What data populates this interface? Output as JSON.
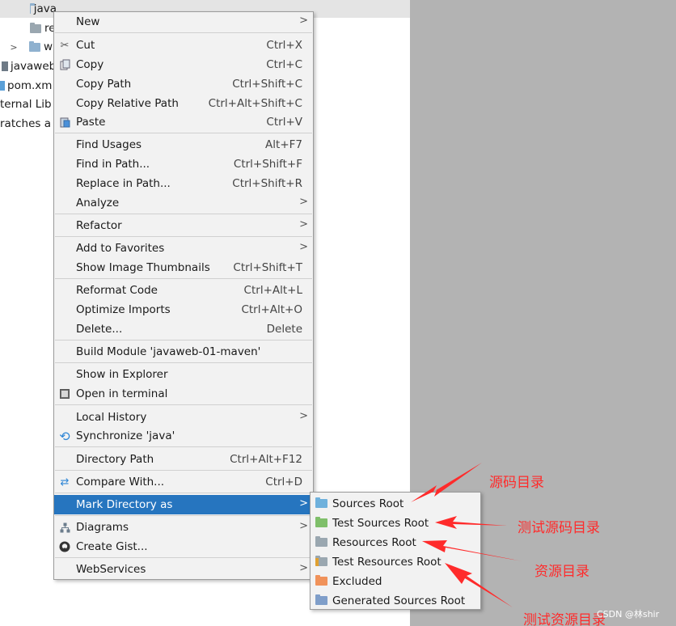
{
  "tree": {
    "rows": [
      {
        "label": "java",
        "icon": "folder-icon"
      },
      {
        "label": "re",
        "icon": "folder-icon"
      },
      {
        "label": "w",
        "icon": "folder-icon"
      },
      {
        "label": "javaweb",
        "icon": "file-icon"
      },
      {
        "label": "pom.xm",
        "icon": "maven-file-icon"
      },
      {
        "label": "ternal Lib",
        "icon": "none"
      },
      {
        "label": "ratches a",
        "icon": "none"
      }
    ]
  },
  "menu": {
    "new": {
      "label": "New",
      "shortcut": ""
    },
    "cut": {
      "label": "Cut",
      "shortcut": "Ctrl+X"
    },
    "copy": {
      "label": "Copy",
      "shortcut": "Ctrl+C"
    },
    "copy_path": {
      "label": "Copy Path",
      "shortcut": "Ctrl+Shift+C"
    },
    "copy_relative_path": {
      "label": "Copy Relative Path",
      "shortcut": "Ctrl+Alt+Shift+C"
    },
    "paste": {
      "label": "Paste",
      "shortcut": "Ctrl+V"
    },
    "find_usages": {
      "label": "Find Usages",
      "shortcut": "Alt+F7"
    },
    "find_in_path": {
      "label": "Find in Path...",
      "shortcut": "Ctrl+Shift+F"
    },
    "replace_in_path": {
      "label": "Replace in Path...",
      "shortcut": "Ctrl+Shift+R"
    },
    "analyze": {
      "label": "Analyze",
      "shortcut": ""
    },
    "refactor": {
      "label": "Refactor",
      "shortcut": ""
    },
    "add_to_favorites": {
      "label": "Add to Favorites",
      "shortcut": ""
    },
    "show_image_thumbnails": {
      "label": "Show Image Thumbnails",
      "shortcut": "Ctrl+Shift+T"
    },
    "reformat_code": {
      "label": "Reformat Code",
      "shortcut": "Ctrl+Alt+L"
    },
    "optimize_imports": {
      "label": "Optimize Imports",
      "shortcut": "Ctrl+Alt+O"
    },
    "delete": {
      "label": "Delete...",
      "shortcut": "Delete"
    },
    "build_module": {
      "label": "Build Module 'javaweb-01-maven'",
      "shortcut": ""
    },
    "show_in_explorer": {
      "label": "Show in Explorer",
      "shortcut": ""
    },
    "open_in_terminal": {
      "label": "Open in terminal",
      "shortcut": ""
    },
    "local_history": {
      "label": "Local History",
      "shortcut": ""
    },
    "synchronize": {
      "label": "Synchronize 'java'",
      "shortcut": ""
    },
    "directory_path": {
      "label": "Directory Path",
      "shortcut": "Ctrl+Alt+F12"
    },
    "compare_with": {
      "label": "Compare With...",
      "shortcut": "Ctrl+D"
    },
    "mark_directory_as": {
      "label": "Mark Directory as",
      "shortcut": ""
    },
    "diagrams": {
      "label": "Diagrams",
      "shortcut": ""
    },
    "create_gist": {
      "label": "Create Gist...",
      "shortcut": ""
    },
    "webservices": {
      "label": "WebServices",
      "shortcut": ""
    }
  },
  "submenu": {
    "items": [
      {
        "label": "Sources Root",
        "color": "#6fb1dc"
      },
      {
        "label": "Test Sources Root",
        "color": "#7fbf6a"
      },
      {
        "label": "Resources Root",
        "color": "#9aa7b0"
      },
      {
        "label": "Test Resources Root",
        "color": "#9aa7b0"
      },
      {
        "label": "Excluded",
        "color": "#f0925a"
      },
      {
        "label": "Generated Sources Root",
        "color": "#7f9ec9"
      }
    ]
  },
  "annotations": {
    "a1": "源码目录",
    "a2": "测试源码目录",
    "a3": "资源目录",
    "a4": "测试资源目录"
  },
  "watermark": "CSDN @林shir",
  "colors": {
    "selection": "#2675bf",
    "annotation": "#ff2b2b",
    "menu_bg": "#f2f2f2"
  }
}
